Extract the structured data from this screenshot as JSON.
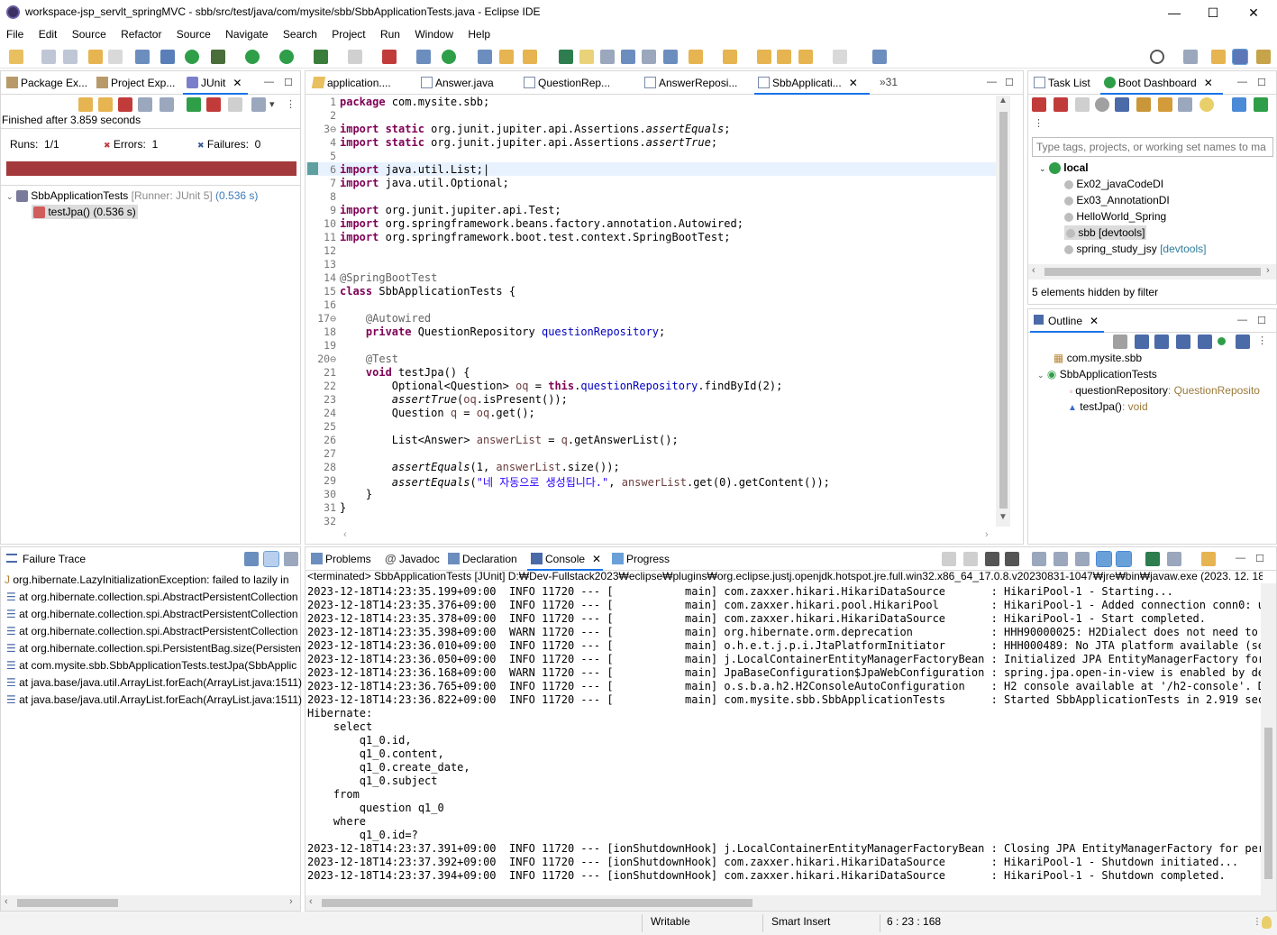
{
  "window": {
    "title": "workspace-jsp_servlt_springMVC - sbb/src/test/java/com/mysite/sbb/SbbApplicationTests.java - Eclipse IDE",
    "min": "—",
    "max": "☐",
    "close": "✕"
  },
  "menu": [
    "File",
    "Edit",
    "Source",
    "Refactor",
    "Source",
    "Navigate",
    "Search",
    "Project",
    "Run",
    "Window",
    "Help"
  ],
  "left_top": {
    "tabs": [
      "Package Ex...",
      "Project Exp...",
      "JUnit"
    ],
    "status": "Finished after 3.859 seconds",
    "runs_label": "Runs:",
    "runs": "1/1",
    "errors_label": "Errors:",
    "errors": "1",
    "failures_label": "Failures:",
    "failures": "0",
    "bar_color": "#a4393c",
    "tree": [
      {
        "label": "SbbApplicationTests",
        "runner": "[Runner: JUnit 5]",
        "time": "(0.536 s)"
      },
      {
        "label": "testJpa()",
        "time": "(0.536 s)"
      }
    ]
  },
  "failure_trace": {
    "title": "Failure Trace",
    "lines": [
      "org.hibernate.LazyInitializationException: failed to lazily in",
      "at org.hibernate.collection.spi.AbstractPersistentCollection",
      "at org.hibernate.collection.spi.AbstractPersistentCollection",
      "at org.hibernate.collection.spi.AbstractPersistentCollection",
      "at org.hibernate.collection.spi.PersistentBag.size(Persisten",
      "at com.mysite.sbb.SbbApplicationTests.testJpa(SbbApplic",
      "at java.base/java.util.ArrayList.forEach(ArrayList.java:1511)",
      "at java.base/java.util.ArrayList.forEach(ArrayList.java:1511)"
    ]
  },
  "editor": {
    "tabs": [
      "application....",
      "Answer.java",
      "QuestionRep...",
      "AnswerReposi...",
      "SbbApplicati..."
    ],
    "overflow": "»31"
  },
  "right_top": {
    "tabs": [
      "Task List",
      "Boot Dashboard"
    ],
    "filter_placeholder": "Type tags, projects, or working set names to ma",
    "root": "local",
    "projects": [
      {
        "name": "Ex02_javaCodeDI",
        "tag": ""
      },
      {
        "name": "Ex03_AnnotationDI",
        "tag": ""
      },
      {
        "name": "HelloWorld_Spring",
        "tag": ""
      },
      {
        "name": "sbb",
        "tag": "[devtools]"
      },
      {
        "name": "spring_study_jsy",
        "tag": "[devtools]"
      }
    ],
    "hidden": "5 elements hidden by filter"
  },
  "outline": {
    "title": "Outline",
    "pkg": "com.mysite.sbb",
    "cls": "SbbApplicationTests",
    "field": "questionRepository",
    "field_type": ": QuestionReposito",
    "method": "testJpa()",
    "method_type": ": void"
  },
  "bottom": {
    "tabs": [
      "Problems",
      "Javadoc",
      "Declaration",
      "Console",
      "Progress"
    ],
    "header": "<terminated> SbbApplicationTests [JUnit] D:₩Dev-Fullstack2023₩eclipse₩plugins₩org.eclipse.justj.openjdk.hotspot.jre.full.win32.x86_64_17.0.8.v20230831-1047₩jre₩bin₩javaw.exe  (2023. 12. 18. 오"
  },
  "statusbar": {
    "writable": "Writable",
    "insert": "Smart Insert",
    "position": "6 : 23 : 168"
  }
}
